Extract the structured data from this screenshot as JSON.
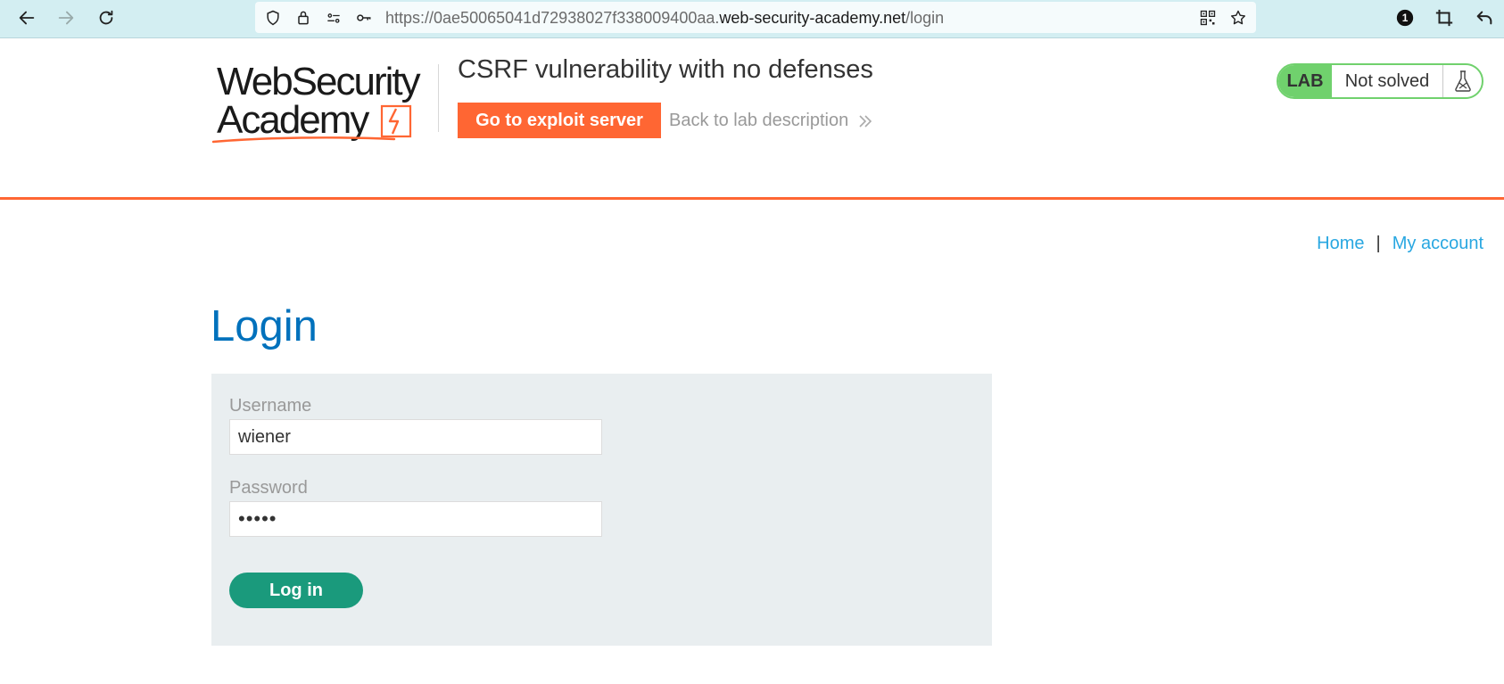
{
  "browser": {
    "url_prefix": "https://0ae50065041d72938027f338009400aa.",
    "url_domain": "web-security-academy.net",
    "url_path": "/login",
    "notification_count": "1"
  },
  "header": {
    "logo_line1": "WebSecurity",
    "logo_line2": "Academy",
    "lab_title": "CSRF vulnerability with no defenses",
    "exploit_button": "Go to exploit server",
    "back_link": "Back to lab description",
    "lab_badge": "LAB",
    "lab_status": "Not solved"
  },
  "nav": {
    "home": "Home",
    "separator": "|",
    "my_account": "My account"
  },
  "login": {
    "title": "Login",
    "username_label": "Username",
    "username_value": "wiener",
    "password_label": "Password",
    "password_value": "peter",
    "submit_label": "Log in"
  },
  "colors": {
    "accent_orange": "#ff6633",
    "login_green": "#1a9a7c",
    "lab_green": "#70d16d",
    "link_blue": "#29a7e1",
    "title_blue": "#0071bc"
  }
}
